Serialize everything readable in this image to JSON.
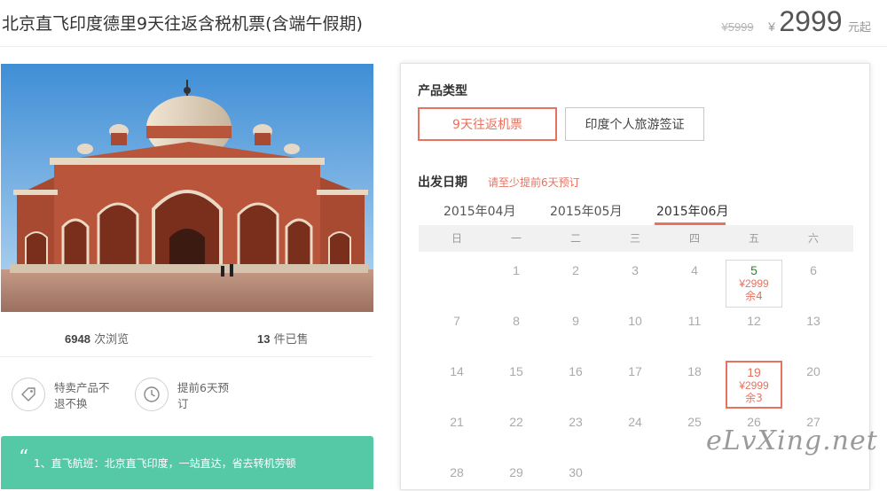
{
  "header": {
    "title": "北京直飞印度德里9天往返含税机票(含端午假期)",
    "old_price": "¥5999",
    "currency": "¥",
    "price": "2999",
    "unit": "元起"
  },
  "stats": [
    {
      "value": "6948",
      "label": "次浏览"
    },
    {
      "value": "13",
      "label": "件已售"
    }
  ],
  "features": [
    {
      "icon": "tag-icon",
      "text": "特卖产品不退不换"
    },
    {
      "icon": "clock-icon",
      "text": "提前6天预订"
    }
  ],
  "highlights": {
    "quote_mark": "“",
    "text": "1、直飞航班：北京直飞印度，一站直达，省去转机劳顿"
  },
  "product": {
    "type_label": "产品类型",
    "options": [
      {
        "label": "9天往返机票",
        "active": true
      },
      {
        "label": "印度个人旅游签证",
        "active": false
      }
    ],
    "date_label": "出发日期",
    "date_note": "请至少提前6天预订",
    "months": [
      {
        "label": "2015年04月",
        "active": false
      },
      {
        "label": "2015年05月",
        "active": false
      },
      {
        "label": "2015年06月",
        "active": true
      }
    ],
    "weekdays": [
      "日",
      "一",
      "二",
      "三",
      "四",
      "五",
      "六"
    ],
    "days": {
      "1": "1",
      "2": "2",
      "3": "3",
      "4": "4",
      "6": "6",
      "7": "7",
      "8": "8",
      "9": "9",
      "10": "10",
      "11": "11",
      "12": "12",
      "13": "13",
      "14": "14",
      "15": "15",
      "16": "16",
      "17": "17",
      "18": "18",
      "20": "20",
      "21": "21",
      "22": "22",
      "23": "23",
      "24": "24",
      "25": "25",
      "26": "26",
      "27": "27",
      "28": "28",
      "29": "29",
      "30": "30"
    },
    "available": {
      "d5": {
        "day": "5",
        "price": "¥2999",
        "stock": "余4"
      },
      "d19": {
        "day": "19",
        "price": "¥2999",
        "stock": "余3"
      }
    }
  },
  "watermark": "eLvXing.net",
  "colors": {
    "accent": "#e7725f",
    "green": "#55c8a5"
  }
}
